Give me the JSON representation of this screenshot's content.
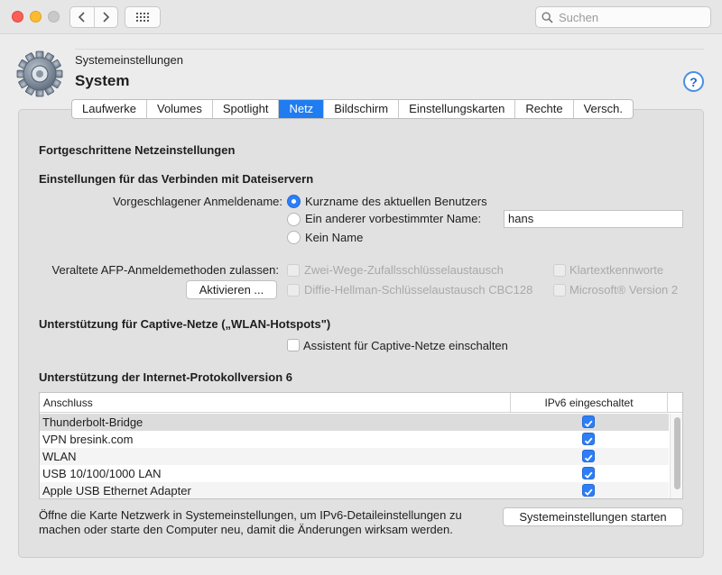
{
  "toolbar": {
    "search_placeholder": "Suchen",
    "back_icon": "chevron-left-icon",
    "forward_icon": "chevron-right-icon",
    "grid_icon": "grid-icon"
  },
  "header": {
    "subtitle": "Systemeinstellungen",
    "title": "System",
    "help": "?"
  },
  "tabs": [
    {
      "label": "Laufwerke",
      "active": false
    },
    {
      "label": "Volumes",
      "active": false
    },
    {
      "label": "Spotlight",
      "active": false
    },
    {
      "label": "Netz",
      "active": true
    },
    {
      "label": "Bildschirm",
      "active": false
    },
    {
      "label": "Einstellungskarten",
      "active": false
    },
    {
      "label": "Rechte",
      "active": false
    },
    {
      "label": "Versch.",
      "active": false
    }
  ],
  "content": {
    "section_title": "Fortgeschrittene Netzeinstellungen",
    "fileservers": {
      "heading": "Einstellungen für das Verbinden mit Dateiservern",
      "login_label": "Vorgeschlagener Anmeldename:",
      "radio_short": "Kurzname des aktuellen Benutzers",
      "radio_other": "Ein anderer vorbestimmter Name:",
      "other_name_value": "hans",
      "radio_none": "Kein Name",
      "selected": "short"
    },
    "afp": {
      "label": "Veraltete AFP-Anmeldemethoden zulassen:",
      "button": "Aktivieren ...",
      "opt1": "Zwei-Wege-Zufallsschlüsselaustausch",
      "opt2": "Klartextkennworte",
      "opt3": "Diffie-Hellman-Schlüsselaustausch CBC128",
      "opt4": "Microsoft® Version 2"
    },
    "captive": {
      "heading": "Unterstützung für Captive-Netze („WLAN-Hotspots\")",
      "checkbox": "Assistent für Captive-Netze einschalten",
      "checked": false
    },
    "ipv6": {
      "heading": "Unterstützung der Internet-Protokollversion 6",
      "col_port": "Anschluss",
      "col_enabled": "IPv6 eingeschaltet",
      "rows": [
        {
          "name": "Thunderbolt-Bridge",
          "enabled": true
        },
        {
          "name": "VPN bresink.com",
          "enabled": true
        },
        {
          "name": "WLAN",
          "enabled": true
        },
        {
          "name": "USB 10/100/1000 LAN",
          "enabled": true
        },
        {
          "name": "Apple USB Ethernet Adapter",
          "enabled": true
        }
      ]
    },
    "footer": {
      "text_line1": "Öffne die Karte Netzwerk in Systemeinstellungen, um IPv6-Detaileinstellungen zu",
      "text_line2": "machen oder starte den Computer neu, damit die Änderungen wirksam werden.",
      "button": "Systemeinstellungen starten"
    }
  },
  "colors": {
    "accent": "#1f7cf1",
    "close": "#fc5f57",
    "minimize": "#fdbc2e"
  }
}
